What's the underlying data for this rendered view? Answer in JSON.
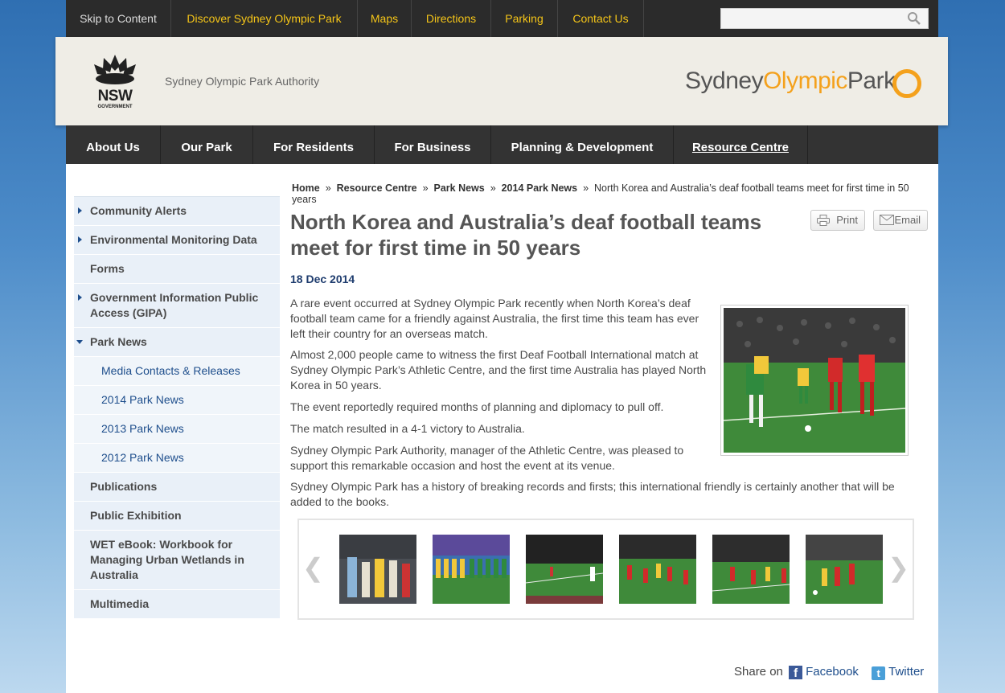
{
  "topbar": {
    "skip": "Skip to Content",
    "links": [
      "Discover Sydney Olympic Park",
      "Maps",
      "Directions",
      "Parking",
      "Contact Us"
    ],
    "search_placeholder": ""
  },
  "header": {
    "nsw_logo_text": "NSW",
    "nsw_logo_sub": "GOVERNMENT",
    "authority": "Sydney Olympic Park Authority",
    "brand_part1": "Sydney",
    "brand_part2": "Olympic",
    "brand_part3": "Park"
  },
  "mainnav": [
    "About Us",
    "Our Park",
    "For Residents",
    "For Business",
    "Planning & Development",
    "Resource Centre"
  ],
  "sidebar": {
    "items": [
      {
        "label": "Community Alerts"
      },
      {
        "label": "Environmental Monitoring Data"
      },
      {
        "label": "Forms"
      },
      {
        "label": "Government Information Public Access (GIPA)"
      },
      {
        "label": "Park News"
      },
      {
        "label": "Media Contacts & Releases"
      },
      {
        "label": "2014 Park News"
      },
      {
        "label": "2013 Park News"
      },
      {
        "label": "2012 Park News"
      },
      {
        "label": "Publications"
      },
      {
        "label": "Public Exhibition"
      },
      {
        "label": "WET eBook: Workbook for Managing Urban Wetlands in Australia"
      },
      {
        "label": "Multimedia"
      }
    ]
  },
  "breadcrumb": {
    "items": [
      "Home",
      "Resource Centre",
      "Park News",
      "2014 Park News"
    ],
    "sep": "»",
    "current": "North Korea and Australia’s deaf football teams meet for first time in 50 years"
  },
  "article": {
    "title": "North Korea and Australia’s deaf football teams meet for first time in 50 years",
    "print_label": "Print",
    "email_label": "Email",
    "date": "18 Dec 2014",
    "paragraphs": [
      "A rare event occurred at Sydney Olympic Park recently when North Korea’s deaf football team came for a friendly against Australia, the first time this team has ever left their country for an overseas match.",
      "Almost 2,000 people came to witness the first Deaf Football International match at Sydney Olympic Park’s Athletic Centre, and the first time Australia has played North Korea in 50 years.",
      "The event reportedly required months of planning and diplomacy to pull off.",
      "The match resulted in a 4-1 victory to Australia.",
      "Sydney Olympic Park Authority, manager of the Athletic Centre, was pleased to support this remarkable occasion and host the event at its venue.",
      "Sydney Olympic Park has a history of breaking records and firsts; this international friendly is certainly another that will be added to the books."
    ]
  },
  "gallery": {
    "prev": "❮",
    "next": "❯"
  },
  "share": {
    "label": "Share on",
    "facebook": "Facebook",
    "twitter": "Twitter"
  },
  "colors": {
    "nav_bg": "#333333",
    "topbar_link": "#f5c518",
    "brand_orange": "#f4a11c",
    "sidebar_bg": "#e9f0f8",
    "link_blue": "#1e4e8c"
  }
}
